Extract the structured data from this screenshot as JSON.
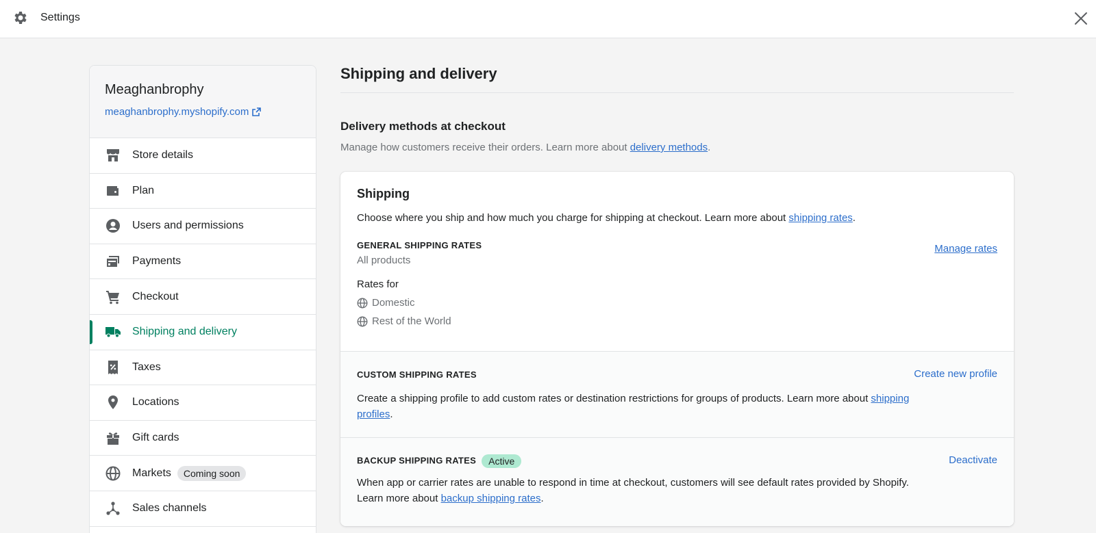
{
  "topbar": {
    "title": "Settings"
  },
  "store": {
    "name": "Meaghanbrophy",
    "url": "meaghanbrophy.myshopify.com"
  },
  "nav": [
    {
      "label": "Store details",
      "icon": "store-icon"
    },
    {
      "label": "Plan",
      "icon": "wallet-icon"
    },
    {
      "label": "Users and permissions",
      "icon": "user-circle-icon"
    },
    {
      "label": "Payments",
      "icon": "payments-icon"
    },
    {
      "label": "Checkout",
      "icon": "cart-icon"
    },
    {
      "label": "Shipping and delivery",
      "icon": "truck-icon",
      "active": true
    },
    {
      "label": "Taxes",
      "icon": "receipt-percent-icon"
    },
    {
      "label": "Locations",
      "icon": "location-pin-icon"
    },
    {
      "label": "Gift cards",
      "icon": "gift-icon"
    },
    {
      "label": "Markets",
      "icon": "globe-icon",
      "badge": "Coming soon"
    },
    {
      "label": "Sales channels",
      "icon": "channels-icon"
    }
  ],
  "main": {
    "title": "Shipping and delivery",
    "delivery": {
      "title": "Delivery methods at checkout",
      "subtitle_prefix": "Manage how customers receive their orders. Learn more about ",
      "subtitle_link": "delivery methods",
      "subtitle_suffix": "."
    },
    "shipping": {
      "title": "Shipping",
      "desc_prefix": "Choose where you ship and how much you charge for shipping at checkout. Learn more about ",
      "desc_link": "shipping rates",
      "desc_suffix": ".",
      "general": {
        "heading": "GENERAL SHIPPING RATES",
        "sub": "All products",
        "action": "Manage rates",
        "rates_for": "Rates for",
        "zones": [
          "Domestic",
          "Rest of the World"
        ]
      },
      "custom": {
        "heading": "CUSTOM SHIPPING RATES",
        "action": "Create new profile",
        "text_prefix": "Create a shipping profile to add custom rates or destination restrictions for groups of products. Learn more about ",
        "text_link_1": "shipping",
        "text_link_2": "profiles",
        "text_suffix": "."
      },
      "backup": {
        "heading": "BACKUP SHIPPING RATES",
        "badge": "Active",
        "action": "Deactivate",
        "text_line1": "When app or carrier rates are unable to respond in time at checkout, customers will see default rates provided by Shopify.",
        "text_prefix": "Learn more about ",
        "text_link": "backup shipping rates",
        "text_suffix": "."
      }
    }
  },
  "colors": {
    "accent": "#008060",
    "link": "#2c6ecb",
    "active_badge": "#aee9d1"
  }
}
